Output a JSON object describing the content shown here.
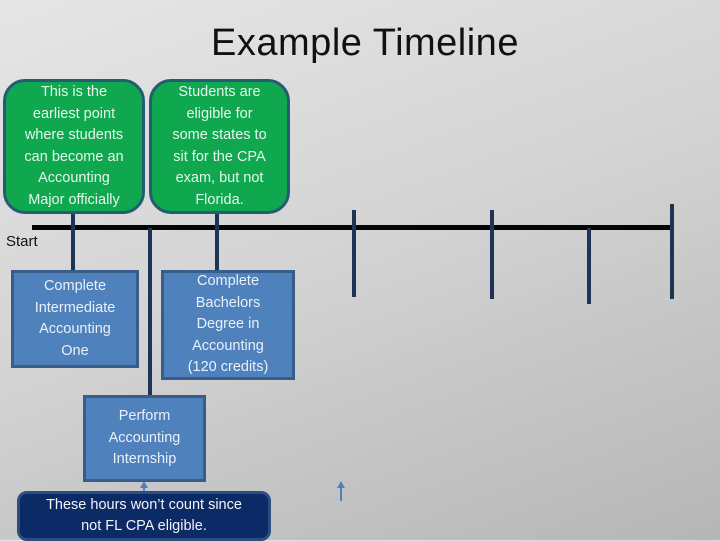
{
  "slide": {
    "title": "Example Timeline",
    "start_label": "Start"
  },
  "above_timeline": [
    {
      "text": "This is the\nearliest point\nwhere students\ncan become an\nAccounting\nMajor officially"
    },
    {
      "text": "Students are\neligible for\nsome states to\nsit for the CPA\nexam, but not\nFlorida."
    }
  ],
  "below_timeline": [
    {
      "text": "Complete\nIntermediate\nAccounting\nOne"
    },
    {
      "text": "Complete\nBachelors\nDegree in\nAccounting\n(120 credits)"
    },
    {
      "text": "Perform\nAccounting\nInternship"
    }
  ],
  "note": {
    "text": "These hours won’t count since\nnot FL CPA eligible."
  },
  "colors": {
    "green_box": "#0fa84e",
    "blue_box": "#4f81bd",
    "navy_box": "#0c2a66",
    "tick_line": "#1e3356",
    "axis": "#050505"
  }
}
